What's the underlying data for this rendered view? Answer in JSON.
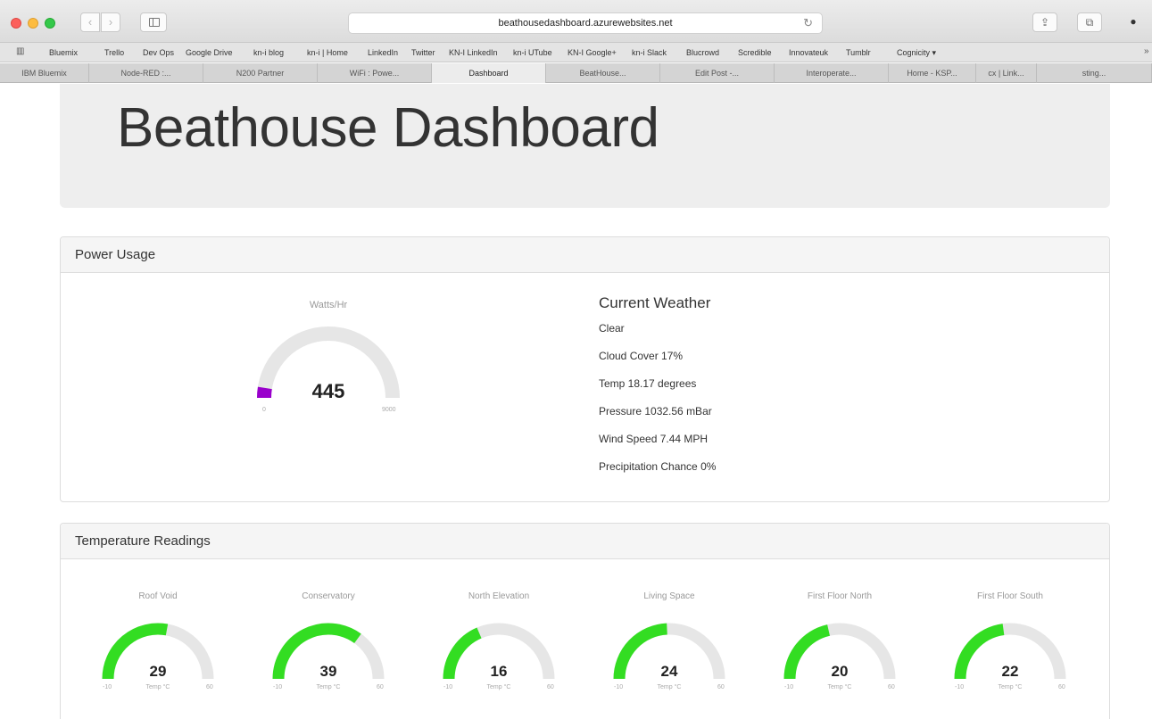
{
  "browser": {
    "url": "beathousedashboard.azurewebsites.net",
    "bookmarks": [
      "Bluemix",
      "Trello",
      "Dev Ops",
      "Google Drive",
      "kn-i blog",
      "kn-i | Home",
      "LinkedIn",
      "Twitter",
      "KN-I LinkedIn",
      "kn-i UTube",
      "KN-I Google+",
      "kn-i Slack",
      "Blucrowd",
      "Scredible",
      "Innovateuk",
      "Tumblr",
      "Cognicity ▾"
    ],
    "tabs": [
      "IBM Bluemix",
      "Node-RED :...",
      "N200 Partner",
      "WiFi : Powe...",
      "Dashboard",
      "BeatHouse...",
      "Edit Post -...",
      "Interoperate...",
      "Home - KSP...",
      "cx | Link...",
      "sting..."
    ]
  },
  "page": {
    "title": "Beathouse Dashboard"
  },
  "power": {
    "heading": "Power Usage",
    "gauge": {
      "title": "Watts/Hr",
      "value": 445,
      "min": 0,
      "max": 9000,
      "min_label": "0",
      "max_label": "9000",
      "color": "#9900cc"
    }
  },
  "weather": {
    "heading": "Current Weather",
    "lines": [
      "Clear",
      "Cloud Cover 17%",
      "Temp 18.17 degrees",
      "Pressure 1032.56 mBar",
      "Wind Speed 7.44 MPH",
      "Precipitation Chance 0%"
    ]
  },
  "temperature": {
    "heading": "Temperature Readings",
    "unit_label": "Temp °C",
    "min": -10,
    "max": 60,
    "min_label": "-10",
    "max_label": "60",
    "color": "#33dd22",
    "track_color": "#e6e6e6",
    "gauges": [
      {
        "title": "Roof Void",
        "value": 29
      },
      {
        "title": "Conservatory",
        "value": 39
      },
      {
        "title": "North Elevation",
        "value": 16
      },
      {
        "title": "Living Space",
        "value": 24
      },
      {
        "title": "First Floor North",
        "value": 20
      },
      {
        "title": "First Floor South",
        "value": 22
      }
    ]
  }
}
